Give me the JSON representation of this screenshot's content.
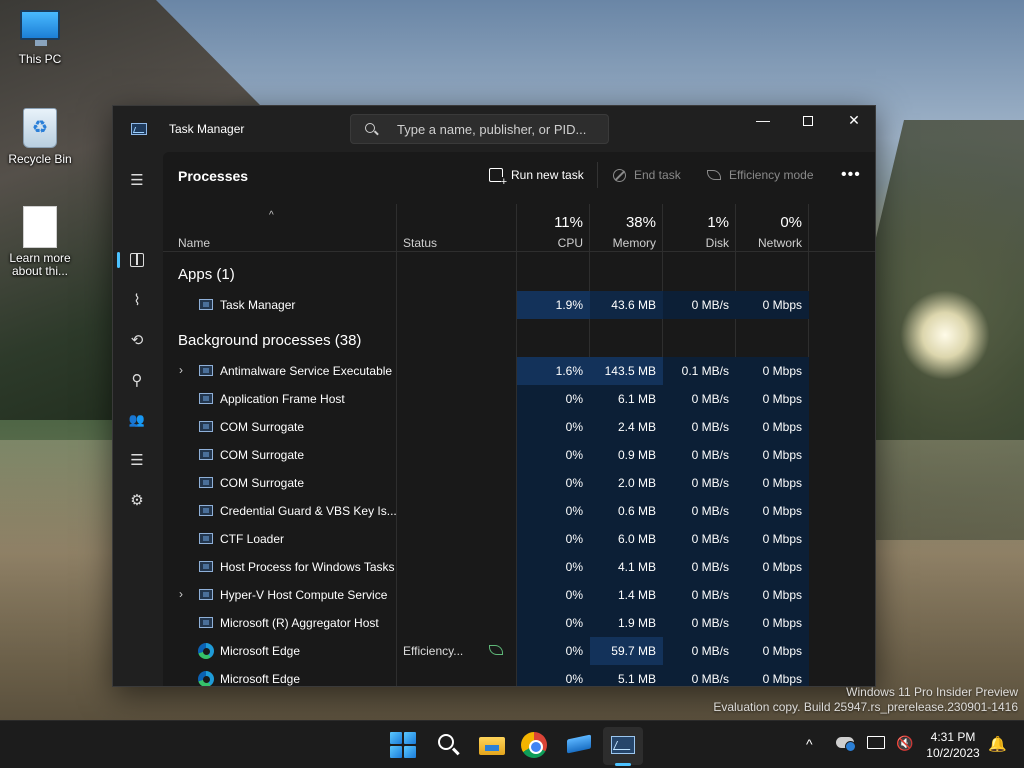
{
  "desktop": {
    "icons": [
      {
        "label": "This PC"
      },
      {
        "label": "Recycle Bin"
      },
      {
        "label": "Learn more about thi..."
      }
    ],
    "watermark_line1": "Windows 11 Pro Insider Preview",
    "watermark_line2": "Evaluation copy. Build 25947.rs_prerelease.230901-1416"
  },
  "window": {
    "title": "Task Manager",
    "search_placeholder": "Type a name, publisher, or PID...",
    "minimize_glyph": "—",
    "close_glyph": "✕"
  },
  "rail": {
    "menu_glyph": "☰",
    "performance_glyph": "⌇",
    "history_glyph": "⟲",
    "startup_glyph": "⚲",
    "users_glyph": "👥",
    "details_glyph": "☰",
    "services_glyph": "⚙",
    "settings_glyph": "⚙"
  },
  "toolbar": {
    "page_title": "Processes",
    "run_new_task": "Run new task",
    "end_task": "End task",
    "efficiency_mode": "Efficiency mode",
    "more": "•••"
  },
  "table": {
    "sort_arrow": "^",
    "headers": {
      "name": "Name",
      "status": "Status",
      "cpu_pct": "11%",
      "cpu": "CPU",
      "memory_pct": "38%",
      "memory": "Memory",
      "disk_pct": "1%",
      "disk": "Disk",
      "network_pct": "0%",
      "network": "Network"
    },
    "apps_section": "Apps (1)",
    "background_section": "Background processes (38)",
    "expand_glyph": "›",
    "rows": [
      {
        "name": "Task Manager",
        "status": "",
        "cpu": "1.9%",
        "memory": "43.6 MB",
        "disk": "0 MB/s",
        "network": "0 Mbps"
      },
      {
        "name": "Antimalware Service Executable",
        "status": "",
        "cpu": "1.6%",
        "memory": "143.5 MB",
        "disk": "0.1 MB/s",
        "network": "0 Mbps"
      },
      {
        "name": "Application Frame Host",
        "status": "",
        "cpu": "0%",
        "memory": "6.1 MB",
        "disk": "0 MB/s",
        "network": "0 Mbps"
      },
      {
        "name": "COM Surrogate",
        "status": "",
        "cpu": "0%",
        "memory": "2.4 MB",
        "disk": "0 MB/s",
        "network": "0 Mbps"
      },
      {
        "name": "COM Surrogate",
        "status": "",
        "cpu": "0%",
        "memory": "0.9 MB",
        "disk": "0 MB/s",
        "network": "0 Mbps"
      },
      {
        "name": "COM Surrogate",
        "status": "",
        "cpu": "0%",
        "memory": "2.0 MB",
        "disk": "0 MB/s",
        "network": "0 Mbps"
      },
      {
        "name": "Credential Guard & VBS Key Is...",
        "status": "",
        "cpu": "0%",
        "memory": "0.6 MB",
        "disk": "0 MB/s",
        "network": "0 Mbps"
      },
      {
        "name": "CTF Loader",
        "status": "",
        "cpu": "0%",
        "memory": "6.0 MB",
        "disk": "0 MB/s",
        "network": "0 Mbps"
      },
      {
        "name": "Host Process for Windows Tasks",
        "status": "",
        "cpu": "0%",
        "memory": "4.1 MB",
        "disk": "0 MB/s",
        "network": "0 Mbps"
      },
      {
        "name": "Hyper-V Host Compute Service",
        "status": "",
        "cpu": "0%",
        "memory": "1.4 MB",
        "disk": "0 MB/s",
        "network": "0 Mbps"
      },
      {
        "name": "Microsoft (R) Aggregator Host",
        "status": "",
        "cpu": "0%",
        "memory": "1.9 MB",
        "disk": "0 MB/s",
        "network": "0 Mbps"
      },
      {
        "name": "Microsoft Edge",
        "status": "Efficiency...",
        "cpu": "0%",
        "memory": "59.7 MB",
        "disk": "0 MB/s",
        "network": "0 Mbps"
      },
      {
        "name": "Microsoft Edge",
        "status": "",
        "cpu": "0%",
        "memory": "5.1 MB",
        "disk": "0 MB/s",
        "network": "0 Mbps"
      }
    ]
  },
  "taskbar": {
    "tray_chevron": "^",
    "volume_glyph": "🔇",
    "bell_glyph": "🔔",
    "time": "4:31 PM",
    "date": "10/2/2023"
  }
}
